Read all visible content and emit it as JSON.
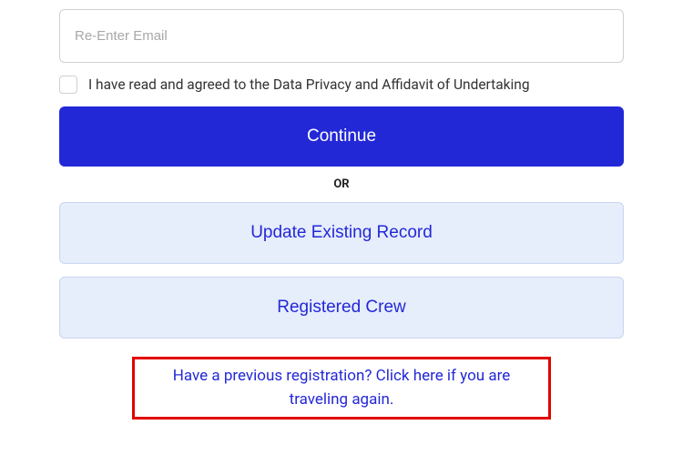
{
  "form": {
    "reenter_email_placeholder": "Re-Enter Email",
    "privacy_label": "I have read and agreed to the Data Privacy and Affidavit of Undertaking",
    "continue_label": "Continue",
    "or_label": "OR",
    "update_record_label": "Update Existing Record",
    "registered_crew_label": "Registered Crew",
    "previous_registration_text": "Have a previous registration? Click here if you are traveling again."
  }
}
